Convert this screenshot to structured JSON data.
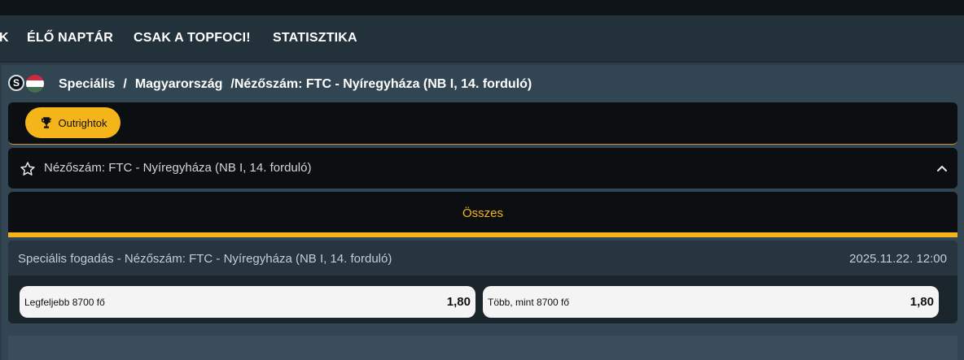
{
  "nav": {
    "items": [
      "K",
      "ÉLŐ NAPTÁR",
      "CSAK A TOPFOCI!",
      "STATISZTIKA"
    ]
  },
  "breadcrumb": {
    "sport_badge": "S",
    "part1": "Speciális",
    "sep": "/",
    "part2": "Magyarország",
    "part3": "/Nézőszám: FTC - Nyíregyháza (NB I, 14. forduló)"
  },
  "outright": {
    "label": "Outrightok",
    "icon": "trophy-icon"
  },
  "event": {
    "title": "Nézőszám: FTC - Nyíregyháza (NB I, 14. forduló)",
    "icon": "star-icon"
  },
  "tabs": {
    "active": "Összes"
  },
  "market": {
    "title": "Speciális fogadás - Nézőszám: FTC - Nyíregyháza (NB I, 14. forduló)",
    "datetime": "2025.11.22. 12:00",
    "odds": [
      {
        "label": "Legfeljebb 8700 fő",
        "value": "1,80"
      },
      {
        "label": "Több, mint 8700 fő",
        "value": "1,80"
      }
    ]
  },
  "colors": {
    "accent": "#f4b51b",
    "background": "#2b3b47",
    "panel": "#0c0f11"
  }
}
